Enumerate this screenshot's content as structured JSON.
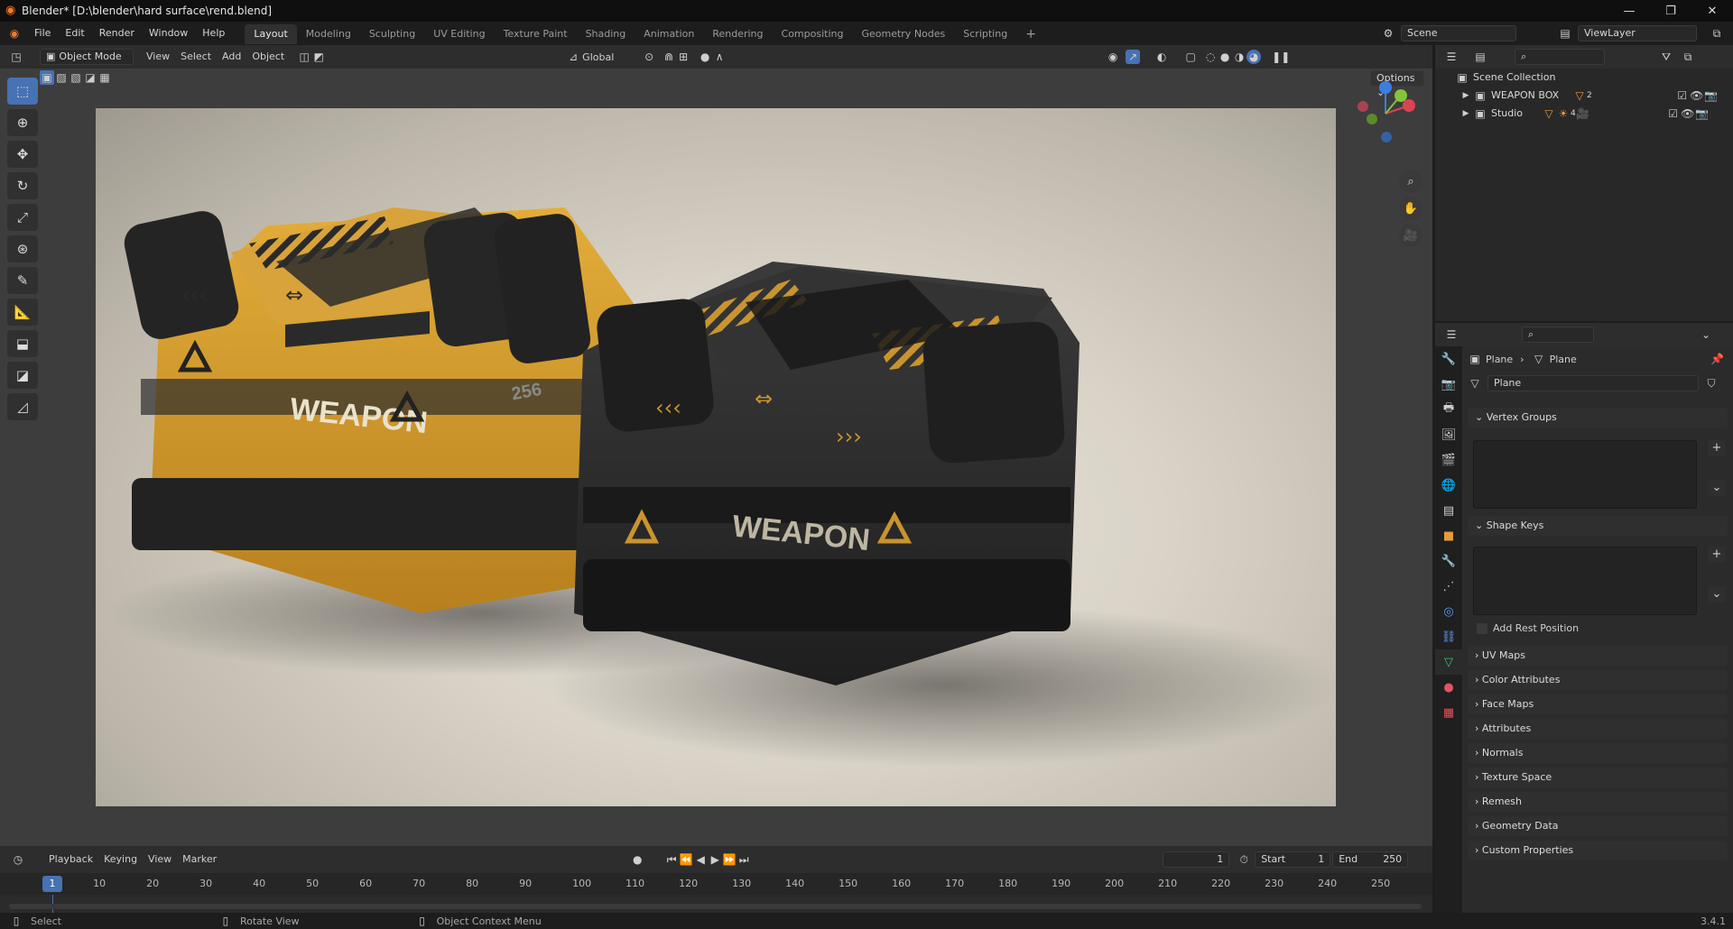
{
  "window": {
    "title": "Blender* [D:\\blender\\hard surface\\rend.blend]"
  },
  "menu": [
    "File",
    "Edit",
    "Render",
    "Window",
    "Help"
  ],
  "workspaces": [
    "Layout",
    "Modeling",
    "Sculpting",
    "UV Editing",
    "Texture Paint",
    "Shading",
    "Animation",
    "Rendering",
    "Compositing",
    "Geometry Nodes",
    "Scripting"
  ],
  "active_workspace": "Layout",
  "scene": {
    "label": "Scene",
    "view_layer": "ViewLayer"
  },
  "viewport_header": {
    "mode": "Object Mode",
    "menus": [
      "View",
      "Select",
      "Add",
      "Object"
    ],
    "orientation": "Global",
    "options": "Options"
  },
  "render": {
    "box1_label": "WEAPON",
    "box2_label": "WEAPON",
    "box1_number": "256"
  },
  "outliner": {
    "root": "Scene Collection",
    "items": [
      {
        "name": "WEAPON BOX",
        "count": "2"
      },
      {
        "name": "Studio",
        "count": "4"
      }
    ]
  },
  "properties": {
    "breadcrumb_object": "Plane",
    "breadcrumb_data": "Plane",
    "data_name": "Plane",
    "panels": {
      "vertex_groups": "Vertex Groups",
      "shape_keys": "Shape Keys",
      "add_rest": "Add Rest Position"
    },
    "collapsed": [
      "UV Maps",
      "Color Attributes",
      "Face Maps",
      "Attributes",
      "Normals",
      "Texture Space",
      "Remesh",
      "Geometry Data",
      "Custom Properties"
    ]
  },
  "timeline": {
    "menus": [
      "Playback",
      "Keying",
      "View",
      "Marker"
    ],
    "current_frame": "1",
    "start_label": "Start",
    "start": "1",
    "end_label": "End",
    "end": "250",
    "ticks": [
      "10",
      "20",
      "30",
      "40",
      "50",
      "60",
      "70",
      "80",
      "90",
      "100",
      "110",
      "120",
      "130",
      "140",
      "150",
      "160",
      "170",
      "180",
      "190",
      "200",
      "210",
      "220",
      "230",
      "240",
      "250"
    ],
    "cursor": "1"
  },
  "status": {
    "select": "Select",
    "rotate": "Rotate View",
    "context": "Object Context Menu",
    "version": "3.4.1"
  },
  "colors": {
    "accent": "#4772b3",
    "box_orange": "#d9a02c",
    "box_dark": "#2a2a2a"
  }
}
